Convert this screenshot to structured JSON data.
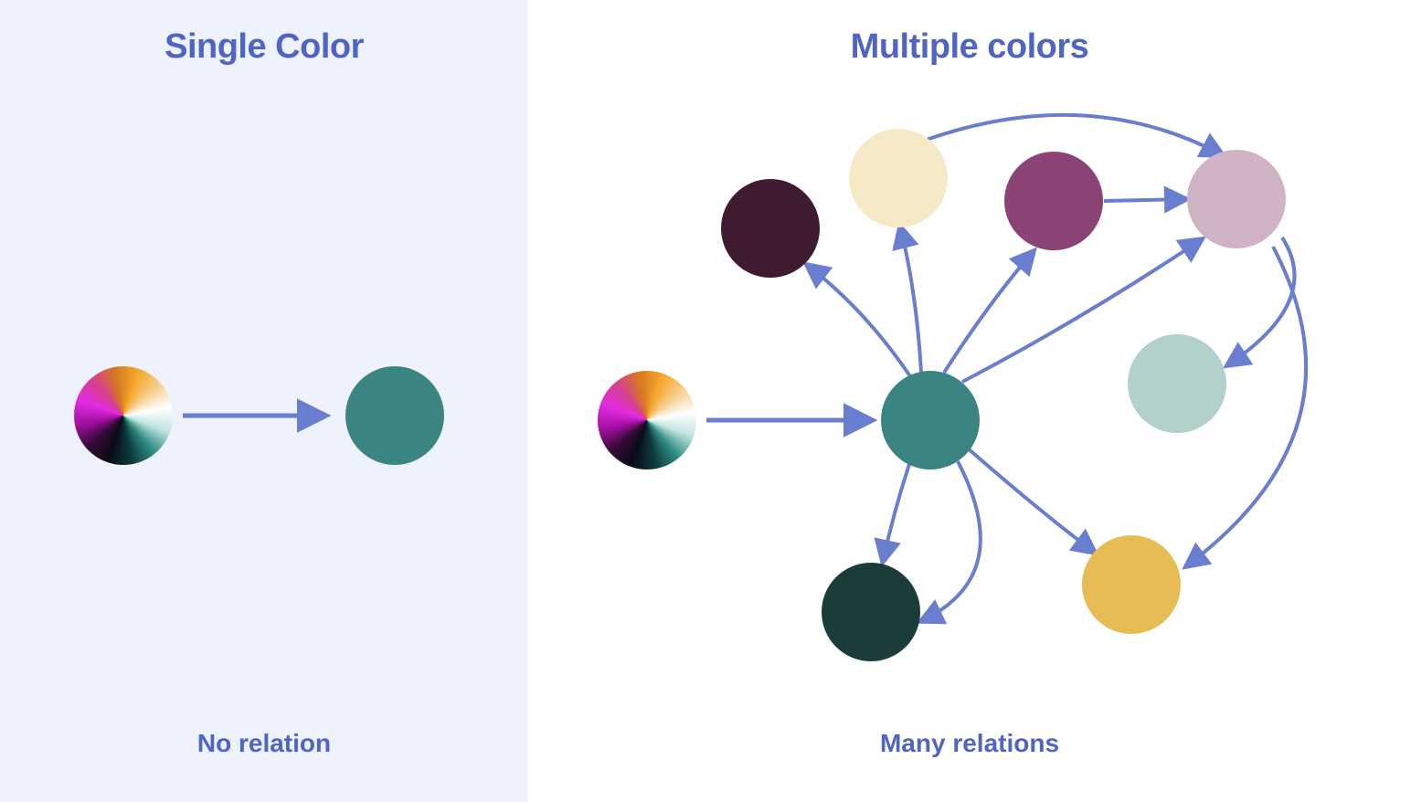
{
  "colors": {
    "accent": "#4f64c4",
    "arrow": "#6a7ed0",
    "teal": "#3a8482",
    "dark_plum": "#3f1b32",
    "cream": "#f6e9c6",
    "magenta_plum": "#8b4275",
    "mauve": "#d0b4c6",
    "sage": "#b3d1cb",
    "mustard": "#e8bc54",
    "dark_teal": "#1c3c3a"
  },
  "left": {
    "title": "Single Color",
    "caption": "No relation"
  },
  "right": {
    "title": "Multiple colors",
    "caption": "Many relations"
  }
}
